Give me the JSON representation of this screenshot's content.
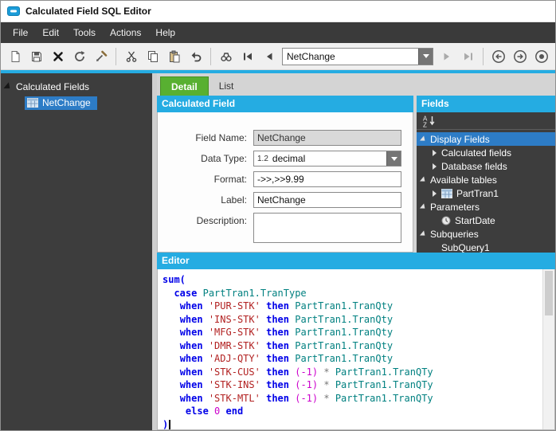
{
  "window": {
    "title": "Calculated Field SQL Editor"
  },
  "menu": {
    "items": [
      "File",
      "Edit",
      "Tools",
      "Actions",
      "Help"
    ]
  },
  "toolbar": {
    "buttons": [
      "new",
      "save",
      "delete",
      "refresh",
      "clear",
      "cut",
      "copy",
      "paste",
      "undo",
      "find",
      "first-record",
      "previous-record",
      "record-selector",
      "next-record",
      "last-record",
      "back",
      "forward",
      "stop"
    ],
    "record_selector": {
      "value": "NetChange"
    }
  },
  "left_tree": {
    "root": "Calculated Fields",
    "selected_item": "NetChange"
  },
  "tabs": {
    "detail": "Detail",
    "list": "List"
  },
  "calculated_field": {
    "header": "Calculated Field",
    "field_name": {
      "label": "Field Name:",
      "value": "NetChange"
    },
    "data_type": {
      "label": "Data Type:",
      "badge": "1.2",
      "value": "decimal"
    },
    "format": {
      "label": "Format:",
      "value": "->>,>>9.99"
    },
    "label_field": {
      "label": "Label:",
      "value": "NetChange"
    },
    "description": {
      "label": "Description:",
      "value": ""
    }
  },
  "fields_panel": {
    "header": "Fields",
    "items": [
      {
        "label": "Display Fields"
      },
      {
        "label": "Calculated fields"
      },
      {
        "label": "Database fields"
      },
      {
        "label": "Available tables"
      },
      {
        "label": "PartTran1"
      },
      {
        "label": "Parameters"
      },
      {
        "label": "StartDate"
      },
      {
        "label": "Subqueries"
      },
      {
        "label": "SubQuery1"
      }
    ]
  },
  "editor": {
    "header": "Editor",
    "lines": [
      [
        [
          "kw",
          "sum("
        ]
      ],
      [
        [
          "pl",
          "  "
        ],
        [
          "kw",
          "case"
        ],
        [
          "pl",
          " "
        ],
        [
          "id",
          "PartTran1.TranType"
        ]
      ],
      [
        [
          "pl",
          "   "
        ],
        [
          "kw",
          "when"
        ],
        [
          "pl",
          " "
        ],
        [
          "str",
          "'PUR-STK'"
        ],
        [
          "pl",
          " "
        ],
        [
          "kw",
          "then"
        ],
        [
          "pl",
          " "
        ],
        [
          "id",
          "PartTran1.TranQty"
        ]
      ],
      [
        [
          "pl",
          "   "
        ],
        [
          "kw",
          "when"
        ],
        [
          "pl",
          " "
        ],
        [
          "str",
          "'INS-STK'"
        ],
        [
          "pl",
          " "
        ],
        [
          "kw",
          "then"
        ],
        [
          "pl",
          " "
        ],
        [
          "id",
          "PartTran1.TranQty"
        ]
      ],
      [
        [
          "pl",
          "   "
        ],
        [
          "kw",
          "when"
        ],
        [
          "pl",
          " "
        ],
        [
          "str",
          "'MFG-STK'"
        ],
        [
          "pl",
          " "
        ],
        [
          "kw",
          "then"
        ],
        [
          "pl",
          " "
        ],
        [
          "id",
          "PartTran1.TranQty"
        ]
      ],
      [
        [
          "pl",
          "   "
        ],
        [
          "kw",
          "when"
        ],
        [
          "pl",
          " "
        ],
        [
          "str",
          "'DMR-STK'"
        ],
        [
          "pl",
          " "
        ],
        [
          "kw",
          "then"
        ],
        [
          "pl",
          " "
        ],
        [
          "id",
          "PartTran1.TranQty"
        ]
      ],
      [
        [
          "pl",
          "   "
        ],
        [
          "kw",
          "when"
        ],
        [
          "pl",
          " "
        ],
        [
          "str",
          "'ADJ-QTY'"
        ],
        [
          "pl",
          " "
        ],
        [
          "kw",
          "then"
        ],
        [
          "pl",
          " "
        ],
        [
          "id",
          "PartTran1.TranQty"
        ]
      ],
      [
        [
          "pl",
          "   "
        ],
        [
          "kw",
          "when"
        ],
        [
          "pl",
          " "
        ],
        [
          "str",
          "'STK-CUS'"
        ],
        [
          "pl",
          " "
        ],
        [
          "kw",
          "then"
        ],
        [
          "pl",
          " "
        ],
        [
          "num",
          "(-1)"
        ],
        [
          "op",
          " * "
        ],
        [
          "id",
          "PartTran1.TranQTy"
        ]
      ],
      [
        [
          "pl",
          "   "
        ],
        [
          "kw",
          "when"
        ],
        [
          "pl",
          " "
        ],
        [
          "str",
          "'STK-INS'"
        ],
        [
          "pl",
          " "
        ],
        [
          "kw",
          "then"
        ],
        [
          "pl",
          " "
        ],
        [
          "num",
          "(-1)"
        ],
        [
          "op",
          " * "
        ],
        [
          "id",
          "PartTran1.TranQTy"
        ]
      ],
      [
        [
          "pl",
          "   "
        ],
        [
          "kw",
          "when"
        ],
        [
          "pl",
          " "
        ],
        [
          "str",
          "'STK-MTL'"
        ],
        [
          "pl",
          " "
        ],
        [
          "kw",
          "then"
        ],
        [
          "pl",
          " "
        ],
        [
          "num",
          "(-1)"
        ],
        [
          "op",
          " * "
        ],
        [
          "id",
          "PartTran1.TranQTy"
        ]
      ],
      [
        [
          "pl",
          "    "
        ],
        [
          "kw",
          "else"
        ],
        [
          "pl",
          " "
        ],
        [
          "num",
          "0"
        ],
        [
          "pl",
          " "
        ],
        [
          "kw",
          "end"
        ]
      ],
      [
        [
          "kw",
          ")"
        ],
        [
          "caret",
          ""
        ]
      ]
    ]
  },
  "colors": {
    "accent_cyan": "#25ACE2",
    "tab_green": "#58B031",
    "selection_blue": "#2D7CC6",
    "panel_dark": "#3D3D3D",
    "syntax_keyword": "#0000E8",
    "syntax_identifier": "#008080",
    "syntax_string": "#B22222",
    "syntax_number": "#CC00CC"
  }
}
